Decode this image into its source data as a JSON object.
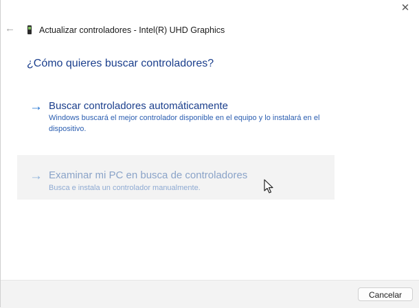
{
  "window": {
    "close_glyph": "✕",
    "back_glyph": "←",
    "title": "Actualizar controladores - Intel(R) UHD Graphics"
  },
  "main": {
    "heading": "¿Cómo quieres buscar controladores?",
    "options": [
      {
        "arrow": "→",
        "title": "Buscar controladores automáticamente",
        "description": "Windows buscará el mejor controlador disponible en el equipo y lo instalará en el dispositivo."
      },
      {
        "arrow": "→",
        "title": "Examinar mi PC en busca de controladores",
        "description": "Busca e instala un controlador manualmente."
      }
    ]
  },
  "footer": {
    "cancel_label": "Cancelar"
  },
  "colors": {
    "link": "#1a3e8c",
    "accent": "#1b6fd0",
    "hover_bg": "#f3f3f3"
  },
  "icons": {
    "title": "device-icon",
    "back": "back-arrow-icon",
    "close": "close-icon",
    "cursor": "mouse-pointer-icon"
  }
}
